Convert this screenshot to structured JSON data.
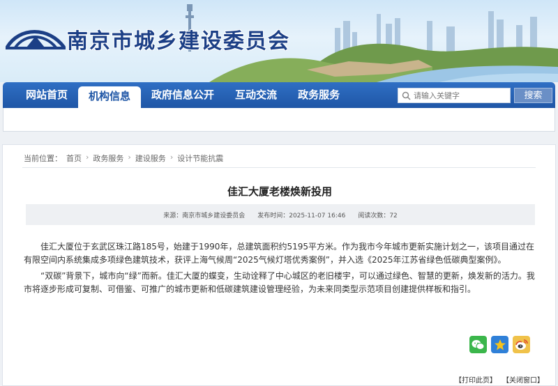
{
  "header": {
    "site_title": "南京市城乡建设委员会"
  },
  "nav": {
    "items": [
      {
        "label": "网站首页"
      },
      {
        "label": "机构信息"
      },
      {
        "label": "政府信息公开"
      },
      {
        "label": "互动交流"
      },
      {
        "label": "政务服务"
      }
    ],
    "active_index": 1
  },
  "search": {
    "placeholder": "请输入关键字",
    "button_label": "搜索"
  },
  "breadcrumb": {
    "prefix": "当前位置：",
    "items": [
      "首页",
      "政务服务",
      "建设服务",
      "设计节能抗震"
    ]
  },
  "article": {
    "title": "佳汇大厦老楼焕新投用",
    "source": "来源：南京市城乡建设委员会",
    "publish_time": "发布时间：2025-11-07 16:46",
    "views": "阅读次数：72",
    "paragraphs": [
      "佳汇大厦位于玄武区珠江路185号，始建于1990年，总建筑面积约5195平方米。作为我市今年城市更新实施计划之一，该项目通过在有限空间内系统集成多项绿色建筑技术，获评上海气候周“2025气候灯塔优秀案例”，并入选《2025年江苏省绿色低碳典型案例》。",
      "“双碳”背景下，城市向“绿”而新。佳汇大厦的蝶变，生动诠释了中心城区的老旧楼宇，可以通过绿色、智慧的更新，焕发新的活力。我市将逐步形成可复制、可借鉴、可推广的城市更新和低碳建筑建设管理经验，为未来同类型示范项目创建提供样板和指引。"
    ]
  },
  "share": {
    "icons": [
      "wechat-icon",
      "qzone-icon",
      "weibo-icon"
    ]
  },
  "footer": {
    "print_label": "【打印此页】",
    "close_label": "【关闭窗口】"
  },
  "colors": {
    "nav_blue": "#1f56a6",
    "title_blue": "#1c3f86"
  }
}
